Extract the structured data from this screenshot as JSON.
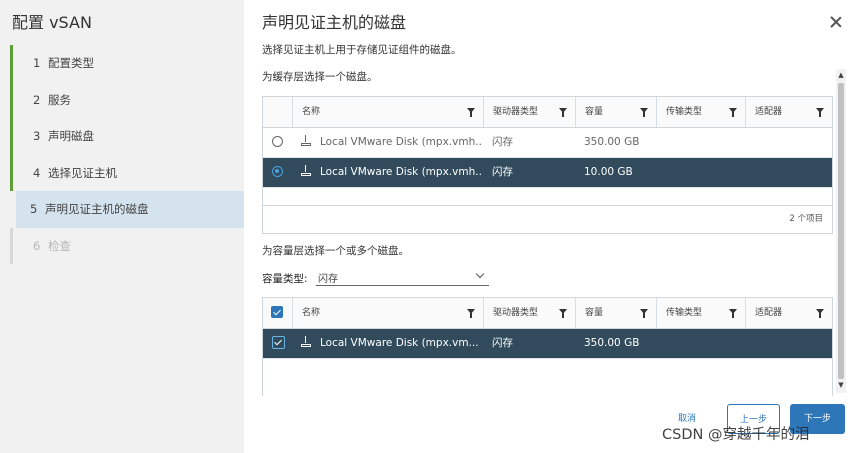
{
  "sidebar": {
    "title": "配置 vSAN",
    "steps": [
      {
        "num": "1",
        "label": "配置类型"
      },
      {
        "num": "2",
        "label": "服务"
      },
      {
        "num": "3",
        "label": "声明磁盘"
      },
      {
        "num": "4",
        "label": "选择见证主机"
      },
      {
        "num": "5",
        "label": "声明见证主机的磁盘"
      },
      {
        "num": "6",
        "label": "检查"
      }
    ]
  },
  "main": {
    "title": "声明见证主机的磁盘",
    "description": "选择见证主机上用于存储见证组件的磁盘。",
    "cache_label": "为缓存层选择一个磁盘。",
    "capacity_label": "为容量层选择一个或多个磁盘。",
    "capacity_type_label": "容量类型:",
    "capacity_type_value": "闪存"
  },
  "columns": {
    "name": "名称",
    "drive_type": "驱动器类型",
    "capacity": "容量",
    "transport": "传输类型",
    "adapter": "适配器"
  },
  "cache_grid": {
    "rows": [
      {
        "name": "Local VMware Disk (mpx.vmh...",
        "drive_type": "闪存",
        "capacity": "350.00 GB",
        "transport": "",
        "adapter": "",
        "selected": false
      },
      {
        "name": "Local VMware Disk (mpx.vmh...",
        "drive_type": "闪存",
        "capacity": "10.00 GB",
        "transport": "",
        "adapter": "",
        "selected": true
      }
    ],
    "footer": "2 个项目"
  },
  "capacity_grid": {
    "rows": [
      {
        "name": "Local VMware Disk (mpx.vm...",
        "drive_type": "闪存",
        "capacity": "350.00 GB",
        "transport": "",
        "adapter": "",
        "selected": true
      }
    ]
  },
  "buttons": {
    "cancel": "取消",
    "back": "上一步",
    "next": "下一步"
  },
  "watermark": "CSDN @穿越千年的泪"
}
